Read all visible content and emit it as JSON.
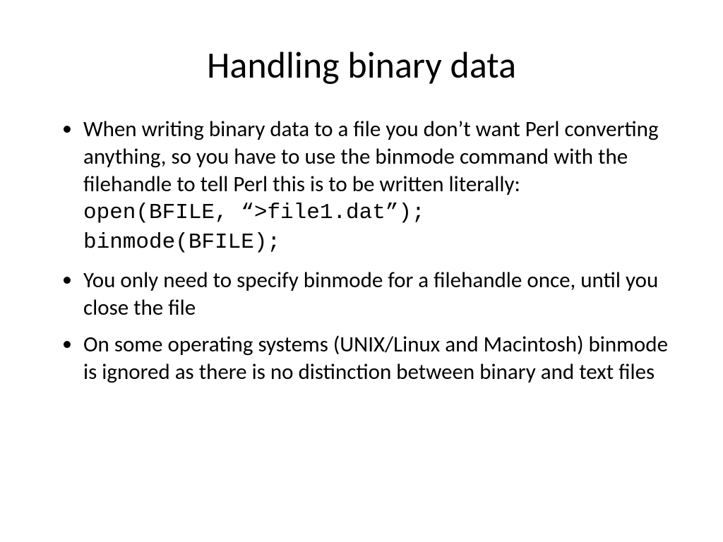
{
  "title": "Handling binary data",
  "bullets": {
    "b1_text": "When writing binary data to a file you don’t want Perl converting anything, so you have to use the binmode command with the filehandle to tell Perl this is to be written literally:",
    "b1_code_line1": "open(BFILE, “>file1.dat”);",
    "b1_code_line2": "binmode(BFILE);",
    "b2_text": "You only need to specify binmode for a filehandle once, until you close the file",
    "b3_text": "On some operating systems (UNIX/Linux and Macintosh) binmode is ignored as there is no distinction between binary and text files"
  }
}
